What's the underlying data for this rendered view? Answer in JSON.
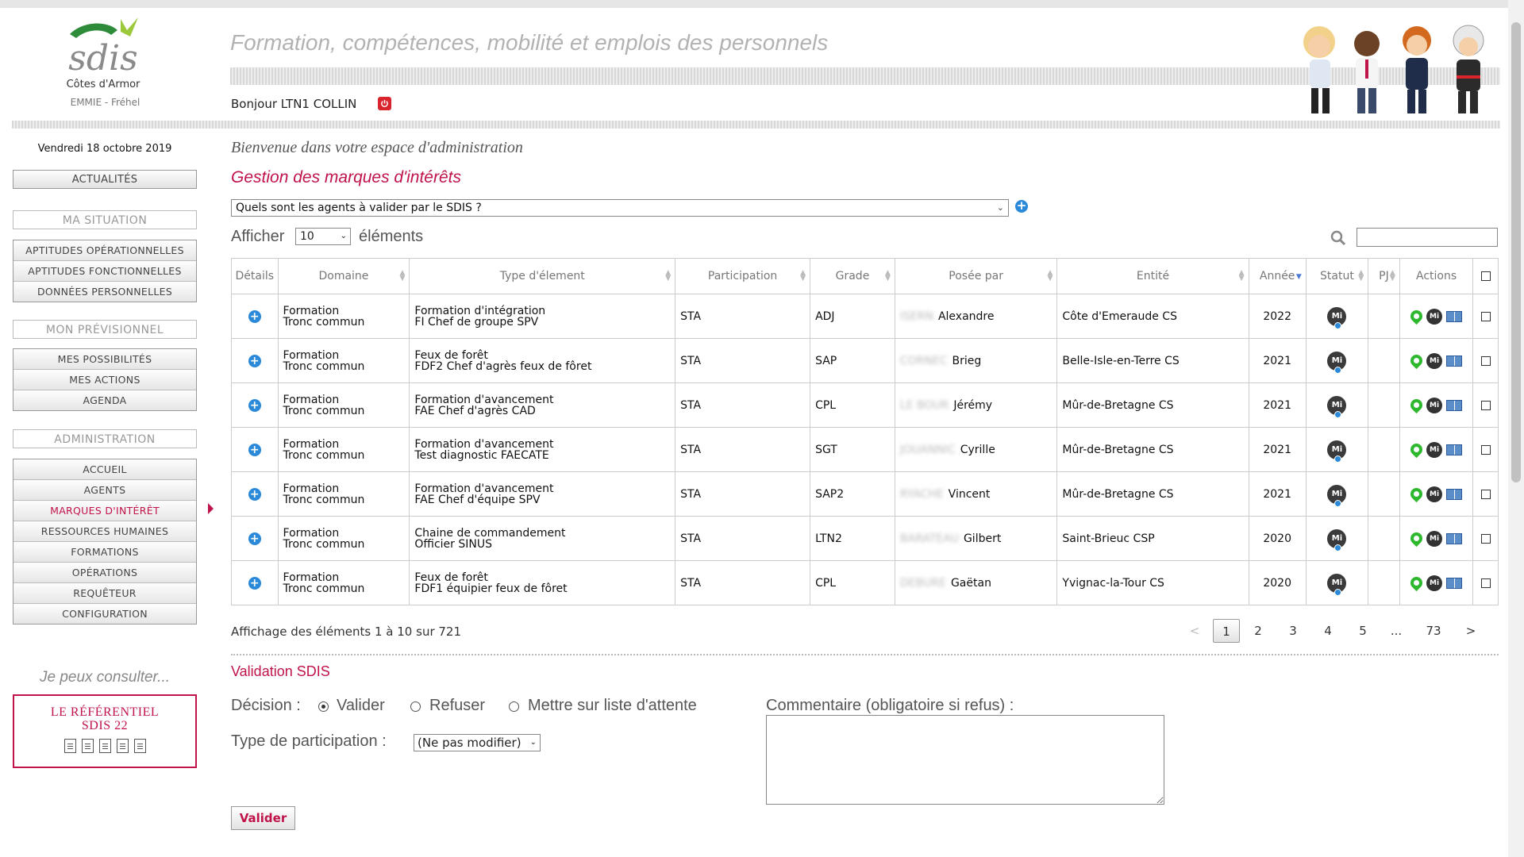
{
  "header": {
    "title": "Formation, compétences, mobilité et emplois des personnels",
    "greeting": "Bonjour LTN1 COLLIN",
    "logo_text": "sdis",
    "logo_region": "Côtes d'Armor",
    "logo_sub": "EMMIE - Fréhel"
  },
  "sidebar": {
    "date": "Vendredi 18 octobre 2019",
    "actualites": "ACTUALITÉS",
    "ma_situation": "MA SITUATION",
    "situation_items": [
      "APTITUDES OPÉRATIONNELLES",
      "APTITUDES FONCTIONNELLES",
      "DONNÉES PERSONNELLES"
    ],
    "mon_previsionnel": "MON PRÉVISIONNEL",
    "previsionnel_items": [
      "MES POSSIBILITÉS",
      "MES ACTIONS",
      "AGENDA"
    ],
    "administration": "ADMINISTRATION",
    "admin_items": [
      "ACCUEIL",
      "AGENTS",
      "MARQUES D'INTÉRÊT",
      "RESSOURCES HUMAINES",
      "FORMATIONS",
      "OPÉRATIONS",
      "REQUÊTEUR",
      "CONFIGURATION"
    ],
    "admin_active": "MARQUES D'INTÉRÊT",
    "consult": "Je peux consulter...",
    "ref_line1": "LE RÉFÉRENTIEL",
    "ref_line2": "SDIS 22"
  },
  "main": {
    "welcome": "Bienvenue dans votre espace d'administration",
    "title": "Gestion des marques d'intérêts",
    "query_value": "Quels sont les agents à valider par le SDIS ?",
    "afficher": "Afficher",
    "page_size": "10",
    "elements": "éléments",
    "columns": [
      "Détails",
      "Domaine",
      "Type d'élement",
      "Participation",
      "Grade",
      "Posée par",
      "Entité",
      "Année",
      "Statut",
      "PJ",
      "Actions"
    ],
    "rows": [
      {
        "domaine1": "Formation",
        "domaine2": "Tronc commun",
        "type1": "Formation d'intégration",
        "type2": "FI Chef de groupe SPV",
        "participation": "STA",
        "grade": "ADJ",
        "nom": "ISERN",
        "prenom": "Alexandre",
        "entite": "Côte d'Emeraude CS",
        "annee": "2022"
      },
      {
        "domaine1": "Formation",
        "domaine2": "Tronc commun",
        "type1": "Feux de forêt",
        "type2": "FDF2 Chef d'agrès feux de fôret",
        "participation": "STA",
        "grade": "SAP",
        "nom": "CORNEC",
        "prenom": "Brieg",
        "entite": "Belle-Isle-en-Terre CS",
        "annee": "2021"
      },
      {
        "domaine1": "Formation",
        "domaine2": "Tronc commun",
        "type1": "Formation d'avancement",
        "type2": "FAE Chef d'agrès CAD",
        "participation": "STA",
        "grade": "CPL",
        "nom": "LE BOUR",
        "prenom": "Jérémy",
        "entite": "Mûr-de-Bretagne CS",
        "annee": "2021"
      },
      {
        "domaine1": "Formation",
        "domaine2": "Tronc commun",
        "type1": "Formation d'avancement",
        "type2": "Test diagnostic FAECATE",
        "participation": "STA",
        "grade": "SGT",
        "nom": "JOUANNIC",
        "prenom": "Cyrille",
        "entite": "Mûr-de-Bretagne CS",
        "annee": "2021"
      },
      {
        "domaine1": "Formation",
        "domaine2": "Tronc commun",
        "type1": "Formation d'avancement",
        "type2": "FAE Chef d'équipe SPV",
        "participation": "STA",
        "grade": "SAP2",
        "nom": "RYACHE",
        "prenom": "Vincent",
        "entite": "Mûr-de-Bretagne CS",
        "annee": "2021"
      },
      {
        "domaine1": "Formation",
        "domaine2": "Tronc commun",
        "type1": "Chaine de commandement",
        "type2": "Officier SINUS",
        "participation": "STA",
        "grade": "LTN2",
        "nom": "BARATEAU",
        "prenom": "Gilbert",
        "entite": "Saint-Brieuc CSP",
        "annee": "2020"
      },
      {
        "domaine1": "Formation",
        "domaine2": "Tronc commun",
        "type1": "Feux de forêt",
        "type2": "FDF1 équipier feux de fôret",
        "participation": "STA",
        "grade": "CPL",
        "nom": "DEBURE",
        "prenom": "Gaëtan",
        "entite": "Yvignac-la-Tour CS",
        "annee": "2020"
      }
    ],
    "status_label": "Mi",
    "showing": "Affichage des éléments 1 à 10 sur 721",
    "pages": [
      "<",
      "1",
      "2",
      "3",
      "4",
      "5",
      "...",
      "73",
      ">"
    ]
  },
  "validation": {
    "title": "Validation SDIS",
    "decision_label": "Décision :",
    "options": [
      "Valider",
      "Refuser",
      "Mettre sur liste d'attente"
    ],
    "selected": "Valider",
    "comment_label": "Commentaire (obligatoire si refus) :",
    "type_label": "Type de participation :",
    "type_value": "(Ne pas modifier)",
    "submit": "Valider"
  },
  "colors": {
    "accent": "#c0134a",
    "blue": "#2a8ad9",
    "green": "#2eb82e"
  }
}
